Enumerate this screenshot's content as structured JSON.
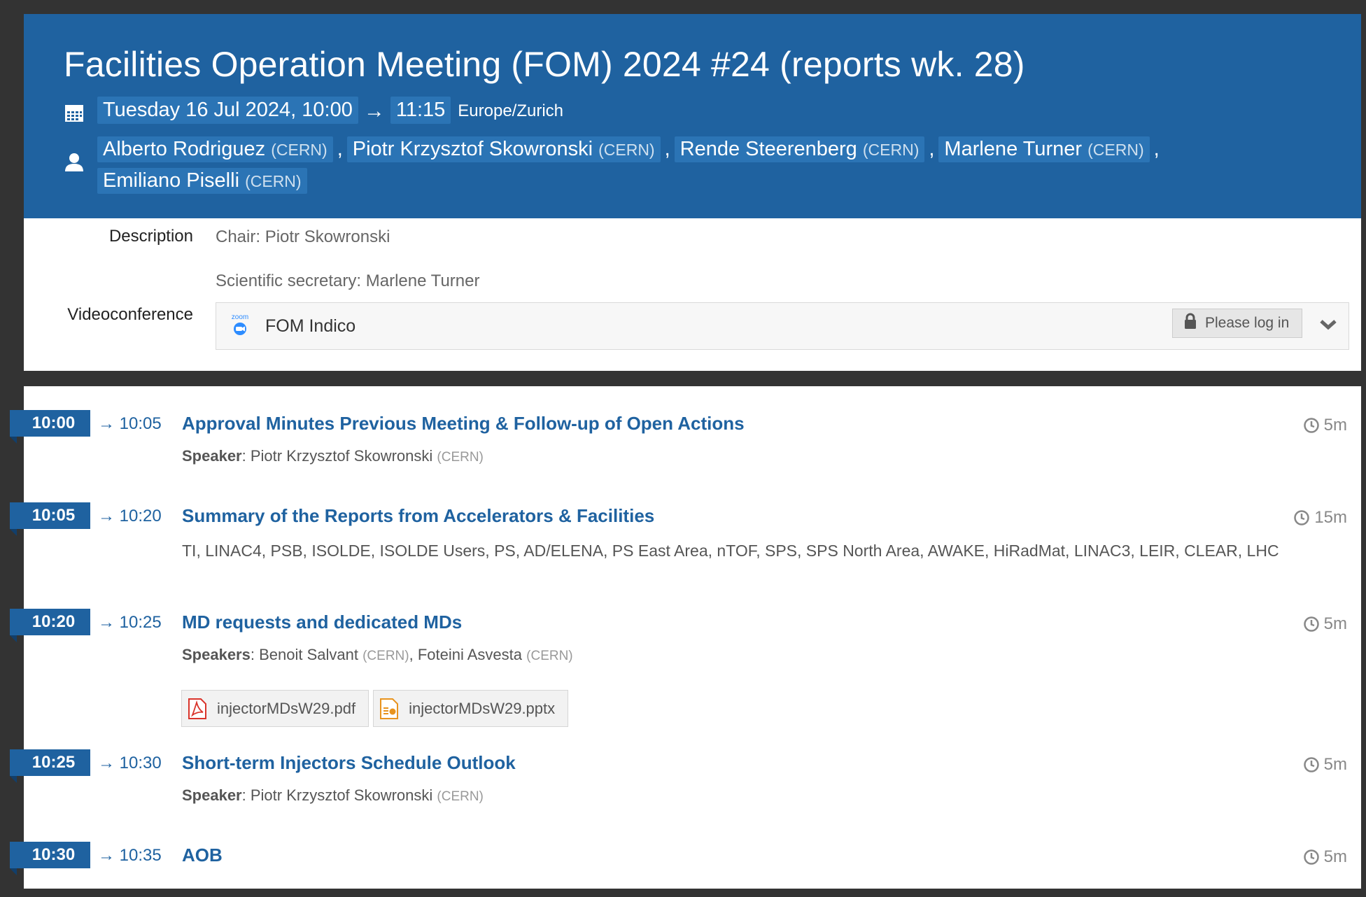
{
  "event": {
    "title": "Facilities Operation Meeting (FOM) 2024 #24 (reports wk. 28)",
    "date_start": "Tuesday 16 Jul 2024, 10:00",
    "arrow": "→",
    "time_end": "11:15",
    "timezone": "Europe/Zurich",
    "chairpersons": [
      {
        "name": "Alberto Rodriguez",
        "affiliation": "(CERN)"
      },
      {
        "name": "Piotr Krzysztof Skowronski",
        "affiliation": "(CERN)"
      },
      {
        "name": "Rende Steerenberg",
        "affiliation": "(CERN)"
      },
      {
        "name": "Marlene Turner",
        "affiliation": "(CERN)"
      },
      {
        "name": "Emiliano Piselli",
        "affiliation": "(CERN)"
      }
    ]
  },
  "info": {
    "description_label": "Description",
    "description_lines": [
      "Chair: Piotr Skowronski",
      "Scientific secretary: Marlene Turner"
    ],
    "vc_label": "Videoconference",
    "vc_logo_text": "zoom",
    "vc_room": "FOM Indico",
    "vc_login": "Please log in"
  },
  "timetable": [
    {
      "start": "10:00",
      "end": "→ 10:05",
      "title": "Approval Minutes Previous Meeting & Follow-up of Open Actions",
      "duration": "5m",
      "speaker_label": "Speaker",
      "speakers": "Piotr Krzysztof Skowronski",
      "speaker_aff": "(CERN)"
    },
    {
      "start": "10:05",
      "end": "→ 10:20",
      "title": "Summary of the Reports from Accelerators & Facilities",
      "duration": "15m",
      "summary": "TI, LINAC4, PSB, ISOLDE, ISOLDE Users, PS, AD/ELENA, PS East Area, nTOF, SPS, SPS North Area, AWAKE, HiRadMat, LINAC3, LEIR, CLEAR, LHC"
    },
    {
      "start": "10:20",
      "end": "→ 10:25",
      "title": "MD requests and dedicated MDs",
      "duration": "5m",
      "speaker_label": "Speakers",
      "speaker1": "Benoit Salvant",
      "speaker1_aff": "(CERN)",
      "speaker2": "Foteini Asvesta",
      "speaker2_aff": "(CERN)",
      "files": [
        "injectorMDsW29.pdf",
        "injectorMDsW29.pptx"
      ]
    },
    {
      "start": "10:25",
      "end": "→ 10:30",
      "title": "Short-term Injectors Schedule Outlook",
      "duration": "5m",
      "speaker_label": "Speaker",
      "speakers": "Piotr Krzysztof Skowronski",
      "speaker_aff": "(CERN)"
    },
    {
      "start": "10:30",
      "end": "→ 10:35",
      "title": "AOB",
      "duration": "5m"
    }
  ]
}
